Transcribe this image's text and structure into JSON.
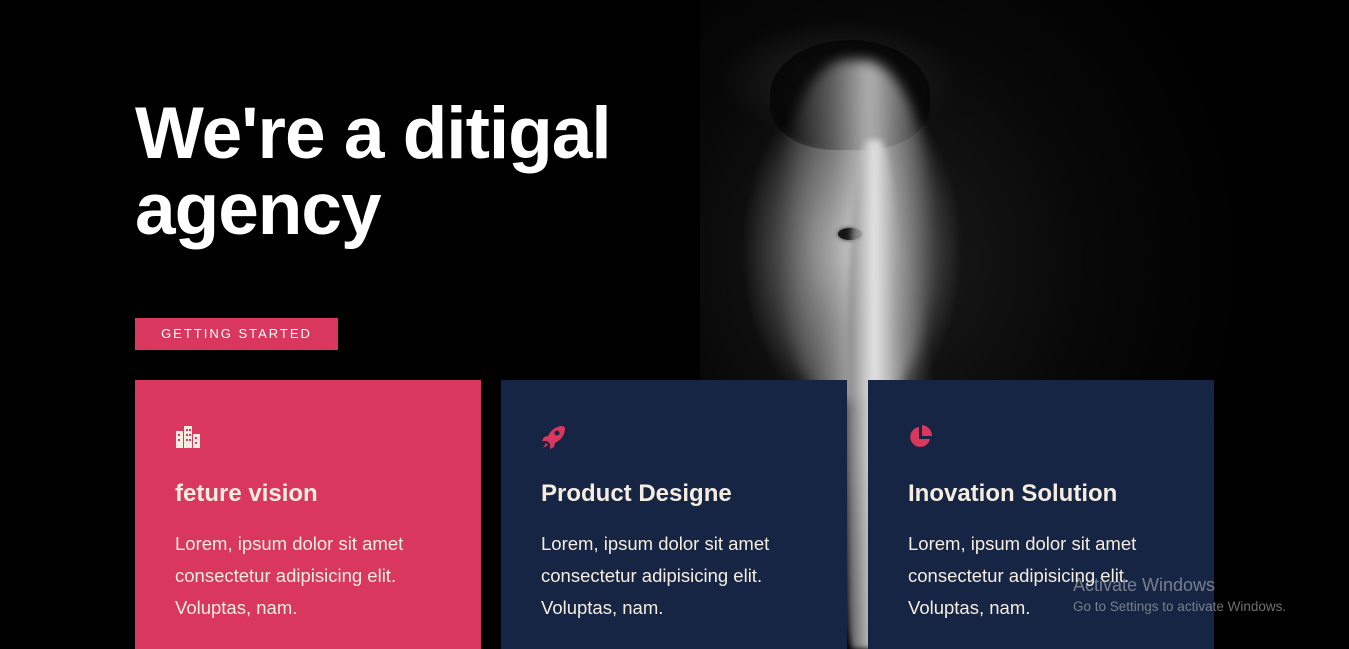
{
  "hero": {
    "headline": "We're a ditigal agency",
    "cta_label": "GETTING STARTED"
  },
  "cards": [
    {
      "icon": "buildings-icon",
      "title": "feture vision",
      "text": "Lorem, ipsum dolor sit amet consectetur adipisicing elit. Voluptas, nam."
    },
    {
      "icon": "rocket-icon",
      "title": "Product Designe",
      "text": "Lorem, ipsum dolor sit amet consectetur adipisicing elit. Voluptas, nam."
    },
    {
      "icon": "pie-chart-icon",
      "title": "Inovation Solution",
      "text": "Lorem, ipsum dolor sit amet consectetur adipisicing elit. Voluptas, nam."
    }
  ],
  "watermark": {
    "title": "Activate Windows",
    "subtitle": "Go to Settings to activate Windows."
  },
  "colors": {
    "accent": "#d9375d",
    "navy": "#162544",
    "background": "#000000",
    "card_text": "#f5ede0"
  }
}
